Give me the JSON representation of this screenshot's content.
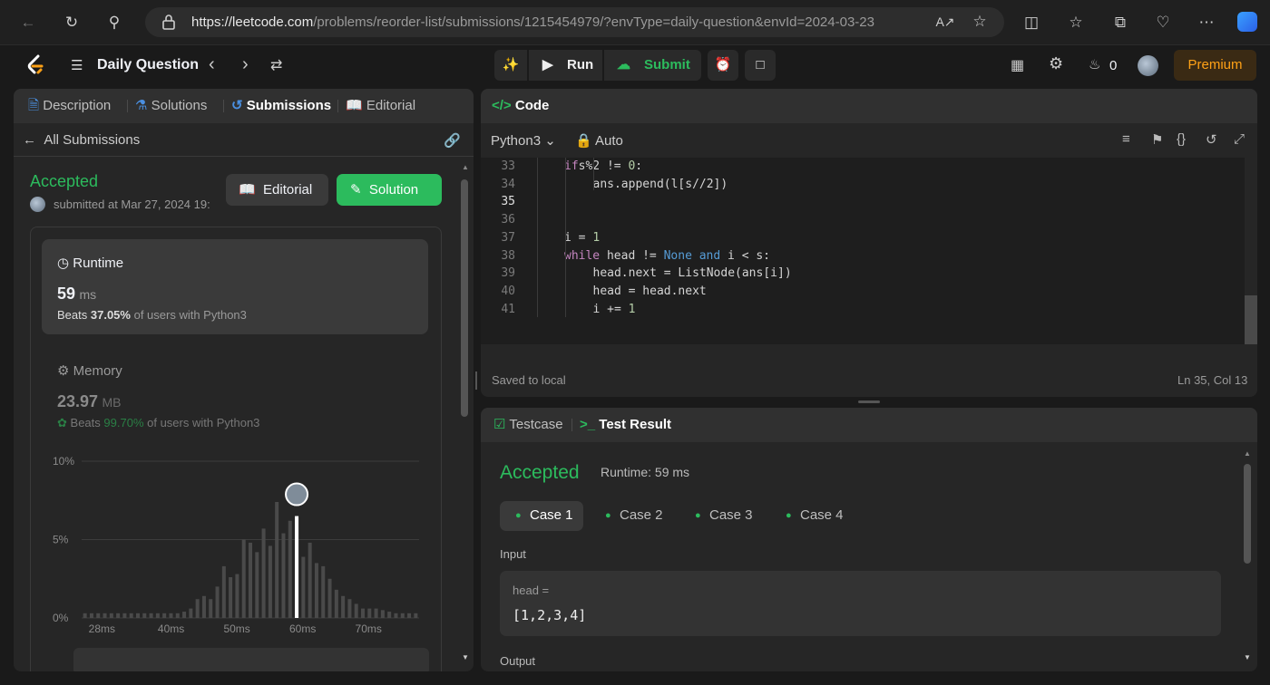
{
  "browser": {
    "url_host": "https://leetcode.com",
    "url_path": "/problems/reorder-list/submissions/1215454979/?envType=daily-question&envId=2024-03-23"
  },
  "header": {
    "title": "Daily Question",
    "run": "Run",
    "submit": "Submit",
    "streak": "0",
    "premium": "Premium"
  },
  "left": {
    "tabs": [
      "Description",
      "Solutions",
      "Submissions",
      "Editorial"
    ],
    "back_label": "All Submissions",
    "status": "Accepted",
    "submitted": "submitted at Mar 27, 2024 19:",
    "editorial_btn": "Editorial",
    "solution_btn": "Solution",
    "runtime": {
      "label": "Runtime",
      "value": "59",
      "unit": "ms",
      "beats_pre": "Beats",
      "beats_pct": "37.05%",
      "beats_post": "of users with Python3"
    },
    "memory": {
      "label": "Memory",
      "value": "23.97",
      "unit": "MB",
      "beats_pre": "Beats",
      "beats_pct": "99.70%",
      "beats_post": "of users with Python3"
    }
  },
  "chart_data": {
    "type": "bar",
    "y_ticks": [
      "10%",
      "5%",
      "0%"
    ],
    "x_ticks": [
      "28ms",
      "40ms",
      "50ms",
      "60ms",
      "70ms"
    ],
    "ylim": [
      0,
      10
    ],
    "values": [
      0.3,
      0.3,
      0.3,
      0.3,
      0.3,
      0.3,
      0.3,
      0.3,
      0.3,
      0.3,
      0.3,
      0.3,
      0.3,
      0.3,
      0.3,
      0.4,
      0.6,
      1.2,
      1.4,
      1.2,
      2.0,
      3.3,
      2.6,
      2.8,
      5.0,
      4.8,
      4.2,
      5.7,
      4.6,
      7.4,
      5.4,
      6.2,
      6.5,
      3.9,
      4.8,
      3.5,
      3.3,
      2.5,
      1.8,
      1.4,
      1.2,
      0.9,
      0.6,
      0.6,
      0.6,
      0.5,
      0.4,
      0.3,
      0.3,
      0.3,
      0.3
    ],
    "highlight_index": 32,
    "highlight_value": 6.5
  },
  "code": {
    "tab": "Code",
    "language": "Python3",
    "mode": "Auto",
    "lines": [
      {
        "n": "33",
        "t": [
          [
            "kw",
            "if"
          ],
          [
            "",
            "s%2 != "
          ],
          [
            "nm",
            "0"
          ],
          [
            "",
            ":"
          ]
        ],
        "indent": 2
      },
      {
        "n": "34",
        "t": [
          [
            "",
            "ans.append(l[s//2])"
          ]
        ],
        "indent": 3
      },
      {
        "n": "35",
        "t": [],
        "indent": 0
      },
      {
        "n": "36",
        "t": [],
        "indent": 0
      },
      {
        "n": "37",
        "t": [
          [
            "",
            "i = "
          ],
          [
            "nm",
            "1"
          ]
        ],
        "indent": 2
      },
      {
        "n": "38",
        "t": [
          [
            "kw",
            "while"
          ],
          [
            "",
            " head != "
          ],
          [
            "bl",
            "None"
          ],
          [
            "",
            ""
          ],
          [
            "bl",
            " and"
          ],
          [
            "",
            " i < s:"
          ]
        ],
        "indent": 2
      },
      {
        "n": "39",
        "t": [
          [
            "",
            "head.next = ListNode(ans[i])"
          ]
        ],
        "indent": 3
      },
      {
        "n": "40",
        "t": [
          [
            "",
            "head = head.next"
          ]
        ],
        "indent": 3
      },
      {
        "n": "41",
        "t": [
          [
            "",
            "i += "
          ],
          [
            "nm",
            "1"
          ]
        ],
        "indent": 3
      }
    ],
    "saved": "Saved to local",
    "cursor": "Ln 35, Col 13"
  },
  "result": {
    "tab_testcase": "Testcase",
    "tab_result": "Test Result",
    "status": "Accepted",
    "runtime": "Runtime: 59 ms",
    "cases": [
      "Case 1",
      "Case 2",
      "Case 3",
      "Case 4"
    ],
    "input_label": "Input",
    "var": "head =",
    "value": "[1,2,3,4]",
    "output_label": "Output"
  }
}
